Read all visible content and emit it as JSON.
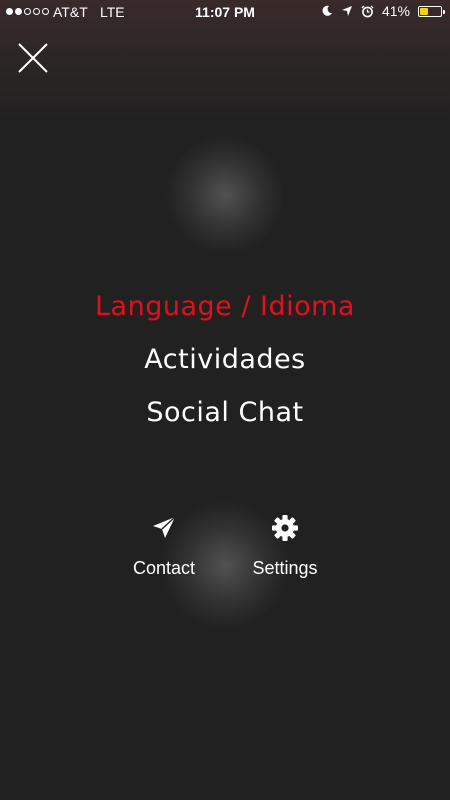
{
  "status_bar": {
    "signal_strength": 2,
    "signal_max": 5,
    "carrier": "AT&T",
    "network": "LTE",
    "time": "11:07 PM",
    "icons": [
      "moon-icon",
      "location-arrow-icon",
      "alarm-icon"
    ],
    "battery_percent": "41%",
    "battery_level": 0.41,
    "battery_color": "#f5d10f"
  },
  "close": {
    "icon": "close-x-icon"
  },
  "menu": {
    "items": [
      {
        "label": "Language / Idioma",
        "active": true
      },
      {
        "label": "Actividades",
        "active": false
      },
      {
        "label": "Social Chat",
        "active": false
      }
    ],
    "active_color": "#e0111a"
  },
  "actions": {
    "contact": {
      "label": "Contact",
      "icon": "paper-plane-icon"
    },
    "settings": {
      "label": "Settings",
      "icon": "gear-icon"
    }
  }
}
